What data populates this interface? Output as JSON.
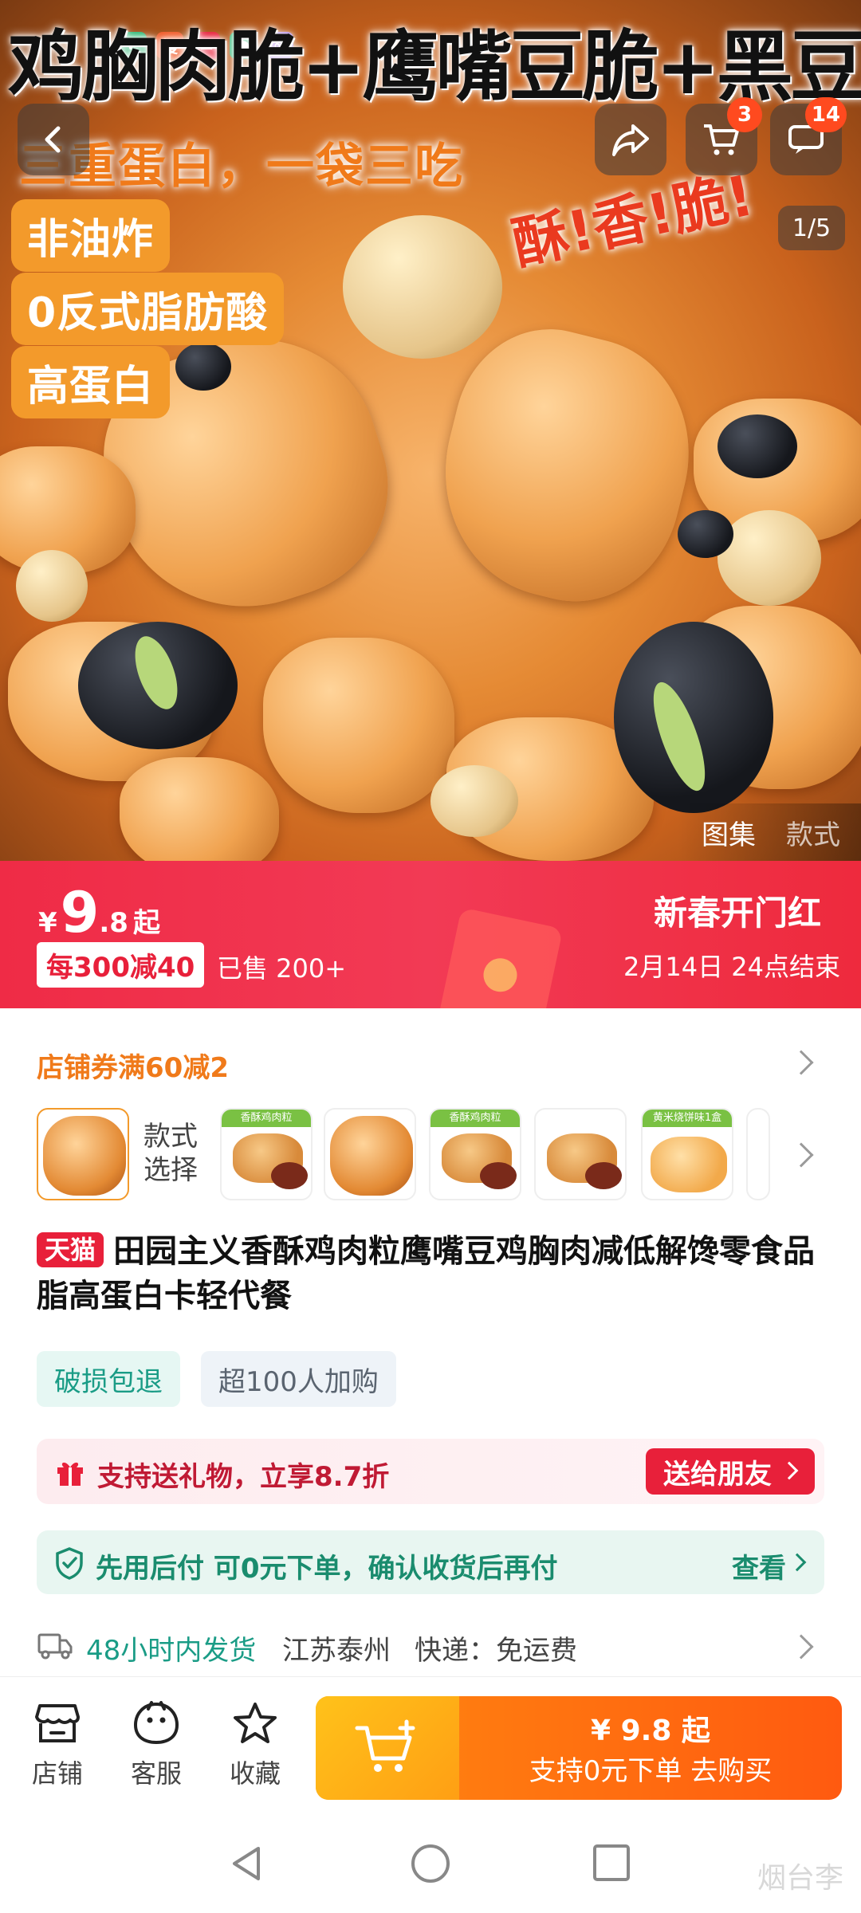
{
  "hero": {
    "title": "鸡胸肉脆+鹰嘴豆脆+黑豆脆",
    "subtitle": "三重蛋白，一袋三吃",
    "tags": [
      "非油炸",
      "0反式脂肪酸",
      "高蛋白"
    ],
    "stamp": "酥!香!脆!",
    "image_counter": "1/5",
    "cart_badge": "3",
    "message_badge": "14",
    "gallery_tabs": [
      "图集",
      "款式"
    ]
  },
  "price": {
    "currency": "¥",
    "integer": "9",
    "decimal": ".8",
    "suffix": "起",
    "discount": "每300减40",
    "sold": "已售 200+"
  },
  "promo": {
    "title": "新春开门红",
    "end_time": "2月14日 24点结束"
  },
  "coupon": {
    "text": "店铺券满60减2"
  },
  "variants": {
    "label": "款式选择",
    "thumb_captions": [
      "香酥鸡肉粒",
      "香酥鸡肉粒",
      "黄米烧饼味1盒"
    ]
  },
  "product": {
    "badge": "天猫",
    "title": "田园主义香酥鸡肉粒鹰嘴豆鸡胸肉减低解馋零食品脂高蛋白卡轻代餐"
  },
  "service_tags": [
    "破损包退",
    "超100人加购"
  ],
  "gift": {
    "text": "支持送礼物，立享8.7折",
    "button": "送给朋友"
  },
  "pay_after": {
    "text": "先用后付 可0元下单，确认收货后再付",
    "link": "查看"
  },
  "shipping": {
    "time": "48小时内发货",
    "origin": "江苏泰州",
    "fee": "快递：免运费"
  },
  "bottom_bar": {
    "store": "店铺",
    "service": "客服",
    "favorite": "收藏",
    "buy_price": "¥ 9.8 起",
    "buy_label": "支持0元下单  去购买"
  },
  "watermark": "烟台李",
  "colors": {
    "tmall_red": "#e8203a",
    "orange_accent": "#f07a1a",
    "teal": "#1a9c86",
    "buy_orange": "#ff5a10"
  }
}
